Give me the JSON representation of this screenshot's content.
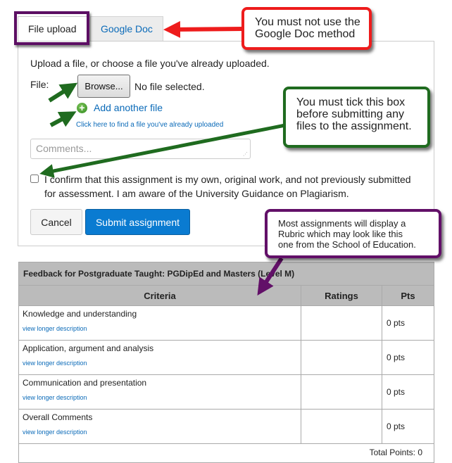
{
  "tabs": [
    {
      "label": "File upload",
      "active": true
    },
    {
      "label": "Google Doc",
      "active": false
    }
  ],
  "upload": {
    "intro": "Upload a file, or choose a file you've already uploaded.",
    "file_label": "File:",
    "browse_label": "Browse...",
    "no_file": "No file selected.",
    "add_another": "Add another file",
    "find_uploaded": "Click here to find a file you've already uploaded",
    "comments_placeholder": "Comments...",
    "confirm_text": "I confirm that this assignment is my own, original work, and not previously submitted for assessment. I am aware of the University Guidance on Plagiarism.",
    "confirm_checked": false,
    "cancel_label": "Cancel",
    "submit_label": "Submit assignment"
  },
  "rubric": {
    "title": "Feedback for Postgraduate Taught: PGDipEd and Masters (Level M)",
    "headers": {
      "criteria": "Criteria",
      "ratings": "Ratings",
      "pts": "Pts"
    },
    "rows": [
      {
        "criterion": "Knowledge and understanding",
        "link": "view longer description",
        "rating": "",
        "pts": "0 pts"
      },
      {
        "criterion": "Application, argument and analysis",
        "link": "view longer description",
        "rating": "",
        "pts": "0 pts"
      },
      {
        "criterion": "Communication and presentation",
        "link": "view longer description",
        "rating": "",
        "pts": "0 pts"
      },
      {
        "criterion": "Overall Comments",
        "link": "view longer description",
        "rating": "",
        "pts": "0 pts"
      }
    ],
    "total": "Total Points: 0"
  },
  "annotations": {
    "red": {
      "text_line1": "You must not use the",
      "text_line2": "Google Doc method",
      "color": "#ee1c1c"
    },
    "green": {
      "text_line1": "You must tick this box",
      "text_line2": "before submitting any",
      "text_line3": "files to the assignment.",
      "color": "#1f6b1f"
    },
    "purple": {
      "text_line1": "Most assignments will display a",
      "text_line2": "Rubric which may look like this",
      "text_line3": "one from the School of Education.",
      "color": "#621068"
    }
  },
  "colors": {
    "link": "#0a6ab8",
    "primary_button": "#0a7bd1",
    "table_header": "#bbbbbb"
  }
}
